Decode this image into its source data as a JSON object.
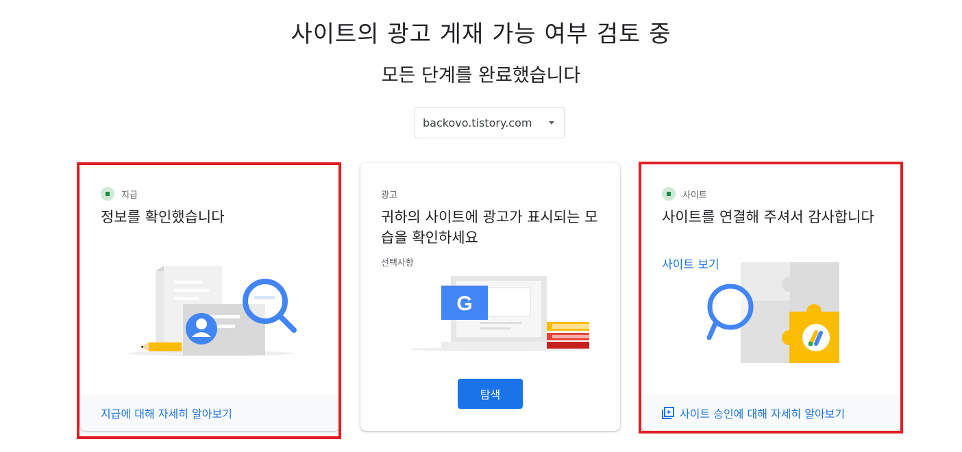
{
  "header": {
    "title": "사이트의 광고 게재 가능 여부 검토 중",
    "subtitle": "모든 단계를 완료했습니다"
  },
  "site_selector": {
    "value": "backovo.tistory.com"
  },
  "cards": [
    {
      "status_label": "지급",
      "heading": "정보를 확인했습니다",
      "footer_link": "지급에 대해 자세히 알아보기"
    },
    {
      "status_label": "광고",
      "heading": "귀하의 사이트에 광고가 표시되는 모습을 확인하세요",
      "optional_label": "선택사항",
      "button_label": "탐색",
      "illustration_letter": "G"
    },
    {
      "status_label": "사이트",
      "heading": "사이트를 연결해 주셔서 감사합니다",
      "link_label": "사이트 보기",
      "footer_link": "사이트 승인에 대해 자세히 알아보기"
    }
  ],
  "colors": {
    "accent_blue": "#1a73e8",
    "status_green": "#1e8e3e",
    "highlight_red": "#e21d26",
    "adsense_yellow": "#fbbc04"
  }
}
